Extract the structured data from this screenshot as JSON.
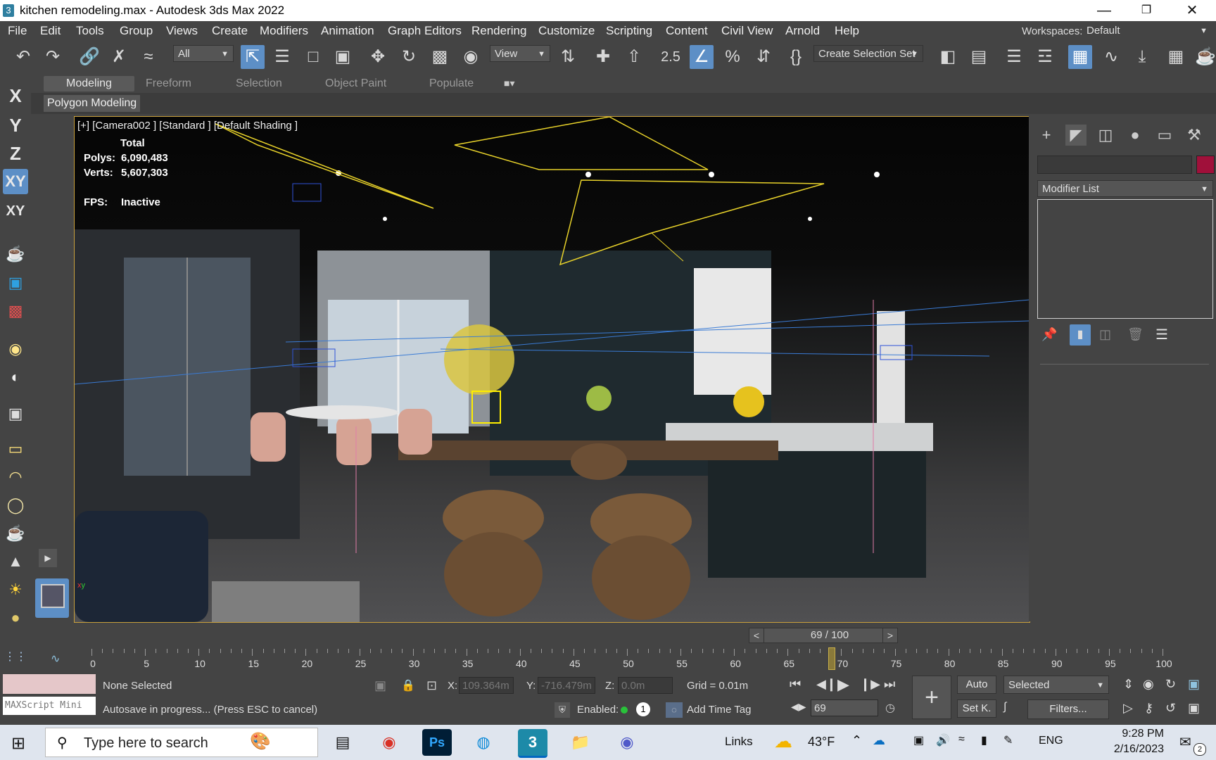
{
  "window": {
    "title": "kitchen remodeling.max - Autodesk 3ds Max 2022",
    "app_icon": "3"
  },
  "menu": [
    "File",
    "Edit",
    "Tools",
    "Group",
    "Views",
    "Create",
    "Modifiers",
    "Animation",
    "Graph Editors",
    "Rendering",
    "Customize",
    "Scripting",
    "Content",
    "Civil View",
    "Arnold",
    "Help"
  ],
  "workspaces": {
    "label": "Workspaces:",
    "value": "Default"
  },
  "toolbar": {
    "filter_value": "All",
    "reference_coord": "View",
    "snap_label": "2.5",
    "selection_set": "Create Selection Set"
  },
  "ribbon_tabs": [
    "Modeling",
    "Freeform",
    "Selection",
    "Object Paint",
    "Populate"
  ],
  "polygon_modeling": "Polygon Modeling",
  "axis_buttons": [
    "X",
    "Y",
    "Z",
    "XY",
    "XY"
  ],
  "viewport": {
    "label": "[+] [Camera002 ] [Standard ] [Default Shading ]",
    "total_label": "Total",
    "polys_label": "Polys:",
    "polys_value": "6,090,483",
    "verts_label": "Verts:",
    "verts_value": "5,607,303",
    "fps_label": "FPS:",
    "fps_value": "Inactive"
  },
  "command_panel": {
    "modifier_list": "Modifier List",
    "swatch_color": "#a0103a"
  },
  "time": {
    "frame_display": "69 / 100",
    "prev": "<",
    "next": ">",
    "ticks": [
      "0",
      "5",
      "10",
      "15",
      "20",
      "25",
      "30",
      "35",
      "40",
      "45",
      "50",
      "55",
      "60",
      "65",
      "70",
      "75",
      "80",
      "85",
      "90",
      "95",
      "100"
    ],
    "current_frame": 69,
    "total_frames": 100
  },
  "status": {
    "selection": "None Selected",
    "autosave": "Autosave in progress... (Press ESC to cancel)",
    "maxscript": "MAXScript Mini",
    "x_label": "X:",
    "x_value": "109.364m",
    "y_label": "Y:",
    "y_value": "-716.479m",
    "z_label": "Z:",
    "z_value": "0.0m",
    "grid": "Grid = 0.01m",
    "enabled_label": "Enabled:",
    "enabled_count": "1",
    "add_time_tag": "Add Time Tag",
    "frame_value": "69",
    "auto_btn": "Auto",
    "setkey_btn": "Set K.",
    "key_filter": "Selected",
    "filters_btn": "Filters..."
  },
  "taskbar": {
    "search_placeholder": "Type here to search",
    "links": "Links",
    "temperature": "43°F",
    "language": "ENG",
    "time": "9:28 PM",
    "date": "2/16/2023",
    "notifications": "2"
  }
}
